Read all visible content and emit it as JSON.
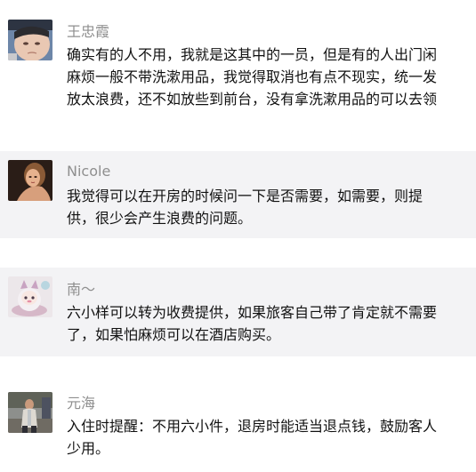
{
  "comments": [
    {
      "author": "王忠霞",
      "avatar": "child-photo-avatar",
      "lines": [
        "确实有的人不用，我就是这其中的一员，但是有的人出门闲",
        "麻烦一般不带洗漱用品，我觉得取消也有点不现实，统一发",
        "放太浪费，还不如放些到前台，没有拿洗漱用品的可以去领"
      ]
    },
    {
      "author": "Nicole",
      "avatar": "woman-photo-avatar",
      "lines": [
        "我觉得可以在开房的时候问一下是否需要，如需要，则提",
        "供，很少会产生浪费的问题。"
      ]
    },
    {
      "author": "南～",
      "avatar": "toy-figure-avatar",
      "lines": [
        "六小样可以转为收费提供，如果旅客自己带了肯定就不需要",
        "了，如果怕麻烦可以在酒店购买。"
      ]
    },
    {
      "author": "元海",
      "avatar": "man-photo-avatar",
      "lines": [
        "入住时提醒：不用六小件，退房时能适当退点钱，鼓励客人",
        "少用。"
      ]
    }
  ]
}
